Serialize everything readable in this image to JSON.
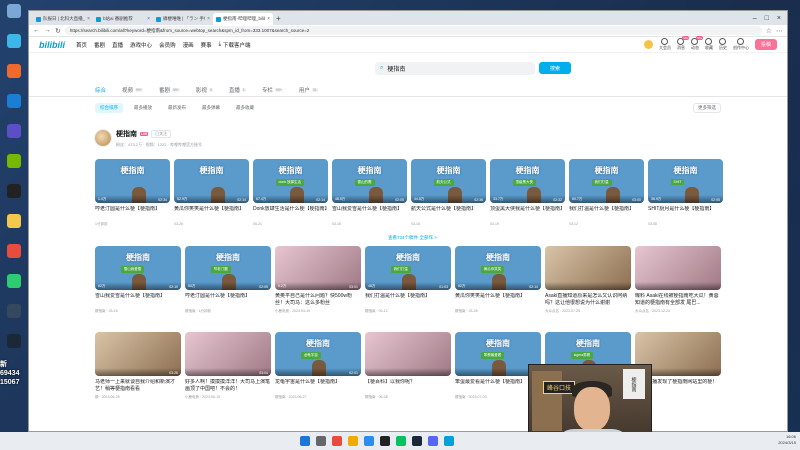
{
  "browser": {
    "tabs": [
      {
        "title": "队报日 | 北科大直播_队报日 | 北科...",
        "active": false
      },
      {
        "title": "b站ai 番剧推荐",
        "active": false
      },
      {
        "title": "磷梗唯唯 | 「ラン 手机 - bilibili",
        "active": false
      },
      {
        "title": "梗指南-哔哩哔哩_bilibili",
        "active": true
      }
    ],
    "url": "https://search.bilibili.com/all?keyword=梗指南&from_source=webtop_search&spm_id_from=333.1007&search_source=2"
  },
  "header": {
    "logo": "bilibili",
    "nav": [
      "首页",
      "番剧",
      "直播",
      "游戏中心",
      "会员购",
      "漫画",
      "赛事"
    ],
    "download": "下载客户端",
    "right": [
      {
        "label": "大会员",
        "badge": ""
      },
      {
        "label": "消息",
        "badge": "99+"
      },
      {
        "label": "动态",
        "badge": "99+"
      },
      {
        "label": "收藏",
        "badge": ""
      },
      {
        "label": "历史",
        "badge": ""
      },
      {
        "label": "创作中心",
        "badge": ""
      }
    ],
    "upload": "投稿"
  },
  "search": {
    "query": "梗指南",
    "button": "搜索"
  },
  "content_tabs": [
    {
      "label": "综合",
      "count": "",
      "active": true
    },
    {
      "label": "视频",
      "count": "99+",
      "active": false
    },
    {
      "label": "番剧",
      "count": "99+",
      "active": false
    },
    {
      "label": "影视",
      "count": "0",
      "active": false
    },
    {
      "label": "直播",
      "count": "1",
      "active": false
    },
    {
      "label": "专栏",
      "count": "99+",
      "active": false
    },
    {
      "label": "用户",
      "count": "31",
      "active": false
    }
  ],
  "filters": {
    "items": [
      "综合排序",
      "最多播放",
      "最新发布",
      "最多弹幕",
      "最多收藏"
    ],
    "more": "更多筛选"
  },
  "upcard": {
    "name": "梗指南",
    "level": "LV6",
    "follow": "已关注",
    "stats": "粉丝：473.2万 · 视频：1222 · 哔哩哔哩官方账号"
  },
  "row1": [
    {
      "thumb": "梗指南",
      "sub": "",
      "views": "1.4万",
      "dur": "02:34",
      "title": "哼老汀圆是什么梗【梗指南】",
      "meta": "1分钟前"
    },
    {
      "thumb": "梗指南",
      "sub": "",
      "views": "52.9万",
      "dur": "02:14",
      "title": "黄瓜你笑笑是什么梗【梗指南】",
      "meta": "03-26"
    },
    {
      "thumb": "梗指南",
      "sub": "donk 放肆生活",
      "views": "67.4万",
      "dur": "02:14",
      "title": "Donk放肆生活是什么梗【梗指南】",
      "meta": "05-21"
    },
    {
      "thumb": "梗指南",
      "sub": "雪山的鹰",
      "views": "48.5万",
      "dur": "02:05",
      "title": "雪山我爱雪是什么梗【梗指南】",
      "meta": "03-16"
    },
    {
      "thumb": "梗指南",
      "sub": "航天公式",
      "views": "44.8万",
      "dur": "02:36",
      "title": "航天公式是什么梗【梗指南】",
      "meta": "03-16"
    },
    {
      "thumb": "梗指南",
      "sub": "顶级黑大侠",
      "views": "33.7万",
      "dur": "02:32",
      "title": "顶蛋黑大侠我是什么梗【梗指南】",
      "meta": "03-19"
    },
    {
      "thumb": "梗指南",
      "sub": "我们打温",
      "views": "60.7万",
      "dur": "03:00",
      "title": "我们打温是什么梗【梗指南】",
      "meta": "03-12"
    },
    {
      "thumb": "梗指南",
      "sub": "SHIT",
      "views": "36.9万",
      "dur": "02:05",
      "title": "SHIT厨月是什么梗【梗指南】",
      "meta": "03-08"
    }
  ],
  "more_link": "查看734个稿件·全部作 >",
  "row2": [
    {
      "thumb": "梗指南",
      "sub": "雪山我爱雪",
      "views": "62万",
      "dur": "02:10",
      "title": "雪山我爱雪是什么梗【梗指南】",
      "meta": "梗指南 · 03-16"
    },
    {
      "thumb": "梗指南",
      "sub": "哼老汀圆",
      "views": "50万",
      "dur": "02:05",
      "title": "哼老汀圆是什么梗【梗指南】",
      "meta": "梗指南 · 1分钟前"
    },
    {
      "thumb": "",
      "sub": "",
      "views": "9.2万",
      "dur": "03:01",
      "title": "黄奥平自己是什么问题？快500w粉丝！大司马：这么多粉丝",
      "meta": "小鹿电竞 · 2023-04-19"
    },
    {
      "thumb": "梗指南",
      "sub": "我们打温",
      "views": "48万",
      "dur": "01:03",
      "title": "我们打温是什么梗【梗指南】",
      "meta": "梗指南 · 03-12"
    },
    {
      "thumb": "梗指南",
      "sub": "黄瓜你笑笑",
      "views": "52万",
      "dur": "02:14",
      "title": "黄瓜你笑笑是什么梗【梗指南】",
      "meta": "梗指南 · 03-26"
    },
    {
      "thumb": "",
      "sub": "",
      "views": "",
      "dur": "",
      "title": "Asaki直播知道原来是怎么又认识阿纳吗？这让他很想说为什么谢谢",
      "meta": "大众点名 · 2023-07-25"
    },
    {
      "thumb": "",
      "sub": "",
      "views": "",
      "dur": "",
      "title": "曝料 Asaki在线被梗指南吃大瓜！黄蓉知道的梗指南有全部发 尾巴...",
      "meta": "大众点名 · 2023-12-24"
    }
  ],
  "row3": [
    {
      "thumb": "",
      "sub": "",
      "views": "",
      "dur": "03:26",
      "title": "马老师一上来就谈自我介绍和新演才艺！稍等梗指南看看",
      "meta": "梗 · 2023-06-28"
    },
    {
      "thumb": "",
      "sub": "",
      "views": "",
      "dur": "03:04",
      "title": "好多人啊！摸摸摸洋洋！大司马上演笔画顶了中国吧！不会的！",
      "meta": "小鹿电竞 · 2023-06-19"
    },
    {
      "thumb": "梗指南",
      "sub": "龙龟宇宙",
      "views": "",
      "dur": "02:01",
      "title": "龙龟宇宙是什么梗【梗指南】",
      "meta": "梗指南 · 2023-06-27"
    },
    {
      "thumb": "",
      "sub": "",
      "views": "",
      "dur": "",
      "title": "【梗百科】以我你呢？",
      "meta": "梗指南 · 05-08"
    },
    {
      "thumb": "梗指南",
      "sub": "笨蛋最爱看",
      "views": "",
      "dur": "",
      "title": "笨蛋最爱看是什么梗【梗指南】",
      "meta": "梗指南 · 2023-07-03"
    },
    {
      "thumb": "梗指南",
      "sub": "sigma男精",
      "views": "",
      "dur": "",
      "title": "sigma男精是什么梗",
      "meta": ""
    },
    {
      "thumb": "",
      "sub": "",
      "views": "",
      "dur": "",
      "title": "Asaki直播发现了梗指南网站里的梗！好啊！",
      "meta": ""
    }
  ],
  "webcam": {
    "sign": "峰谷口技",
    "poster": "梗指南"
  },
  "overlay_text": [
    "新",
    "69434",
    "15067"
  ],
  "taskbar": {
    "time": "16:06",
    "date": "2024/3/15"
  }
}
